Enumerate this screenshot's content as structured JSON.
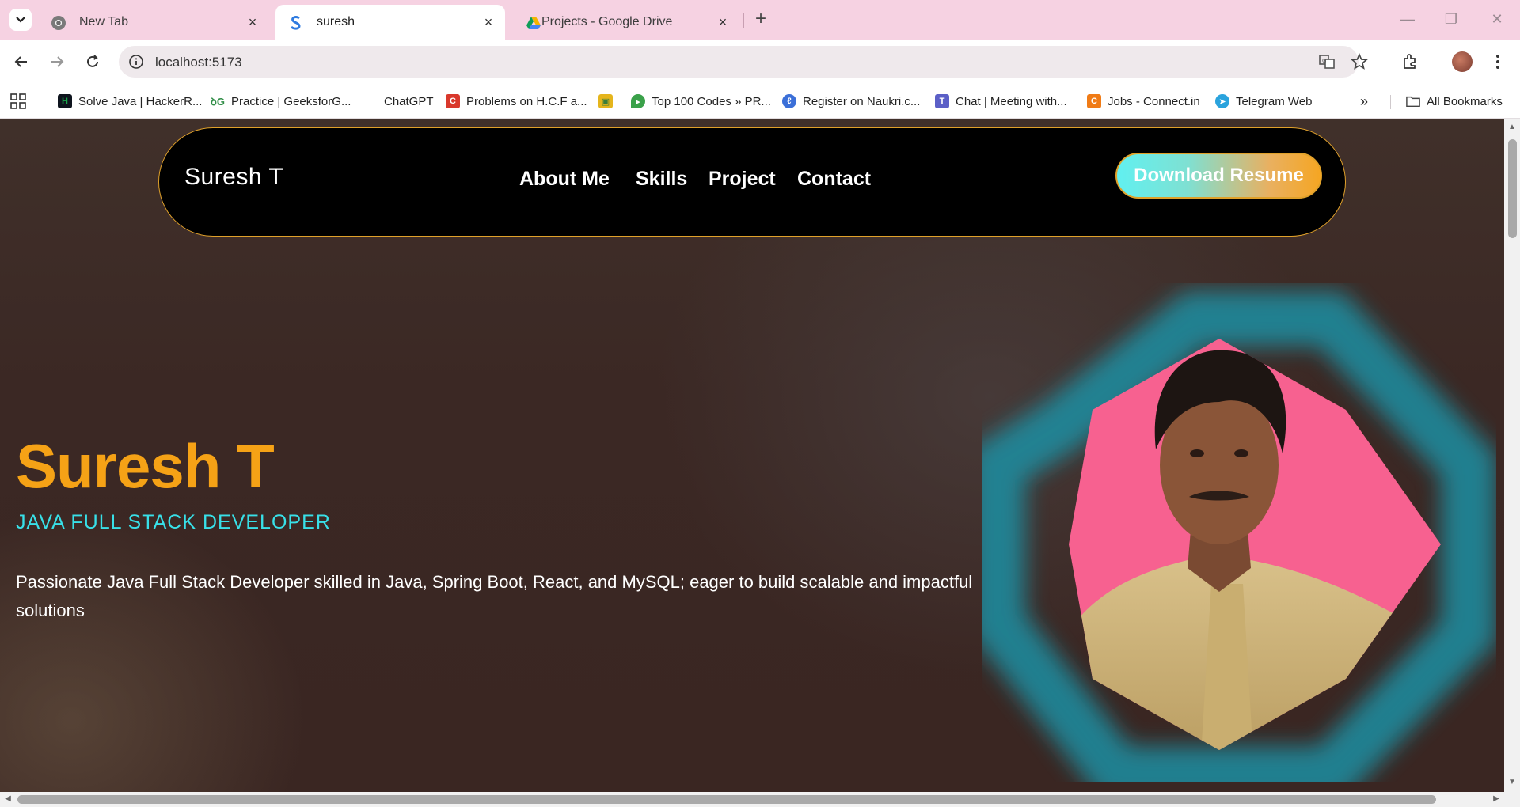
{
  "browser": {
    "tabs": [
      {
        "title": "New Tab",
        "icon": "chrome-icon",
        "active": false
      },
      {
        "title": "suresh",
        "icon": "s-logo-icon",
        "active": true
      },
      {
        "title": "Projects - Google Drive",
        "icon": "google-drive-icon",
        "active": false
      }
    ],
    "new_tab_symbol": "+",
    "url": "localhost:5173",
    "bookmarks": [
      {
        "label": "Solve Java | HackerR...",
        "icon": "hackerrank-icon",
        "color": "#1ba94c"
      },
      {
        "label": "Practice | GeeksforG...",
        "icon": "geeksforgeeks-icon",
        "color": "#2f8d46"
      },
      {
        "label": "ChatGPT",
        "icon": "chatgpt-icon",
        "color": "#ffffff"
      },
      {
        "label": "Problems on H.C.F a...",
        "icon": "c-icon",
        "color": "#d9382c"
      },
      {
        "label": "",
        "icon": "contact-card-icon",
        "color": "#e5b51c"
      },
      {
        "label": "Top 100 Codes » PR...",
        "icon": "prepinsta-icon",
        "color": "#3aa14a"
      },
      {
        "label": "Register on Naukri.c...",
        "icon": "naukri-icon",
        "color": "#3b6fd8"
      },
      {
        "label": "Chat | Meeting with...",
        "icon": "teams-icon",
        "color": "#5b5fc7"
      },
      {
        "label": "Jobs - Connect.in",
        "icon": "connect-icon",
        "color": "#f07b16"
      },
      {
        "label": "Telegram Web",
        "icon": "telegram-icon",
        "color": "#2aa3dd"
      }
    ],
    "all_bookmarks": "All Bookmarks"
  },
  "site": {
    "logo": "Suresh T",
    "nav": [
      "About Me",
      "Skills",
      "Project",
      "Contact"
    ],
    "resume_button": "Download Resume",
    "hero": {
      "name": "Suresh T",
      "role": "JAVA FULL STACK DEVELOPER",
      "description": "Passionate Java Full Stack Developer skilled in Java, Spring Boot, React, and MySQL; eager to build scalable and impactful solutions"
    },
    "colors": {
      "accent_orange": "#f5a216",
      "accent_cyan": "#38e0e8",
      "hexagon_glow": "#1e8fa3",
      "photo_bg_pink": "#f76190"
    }
  }
}
